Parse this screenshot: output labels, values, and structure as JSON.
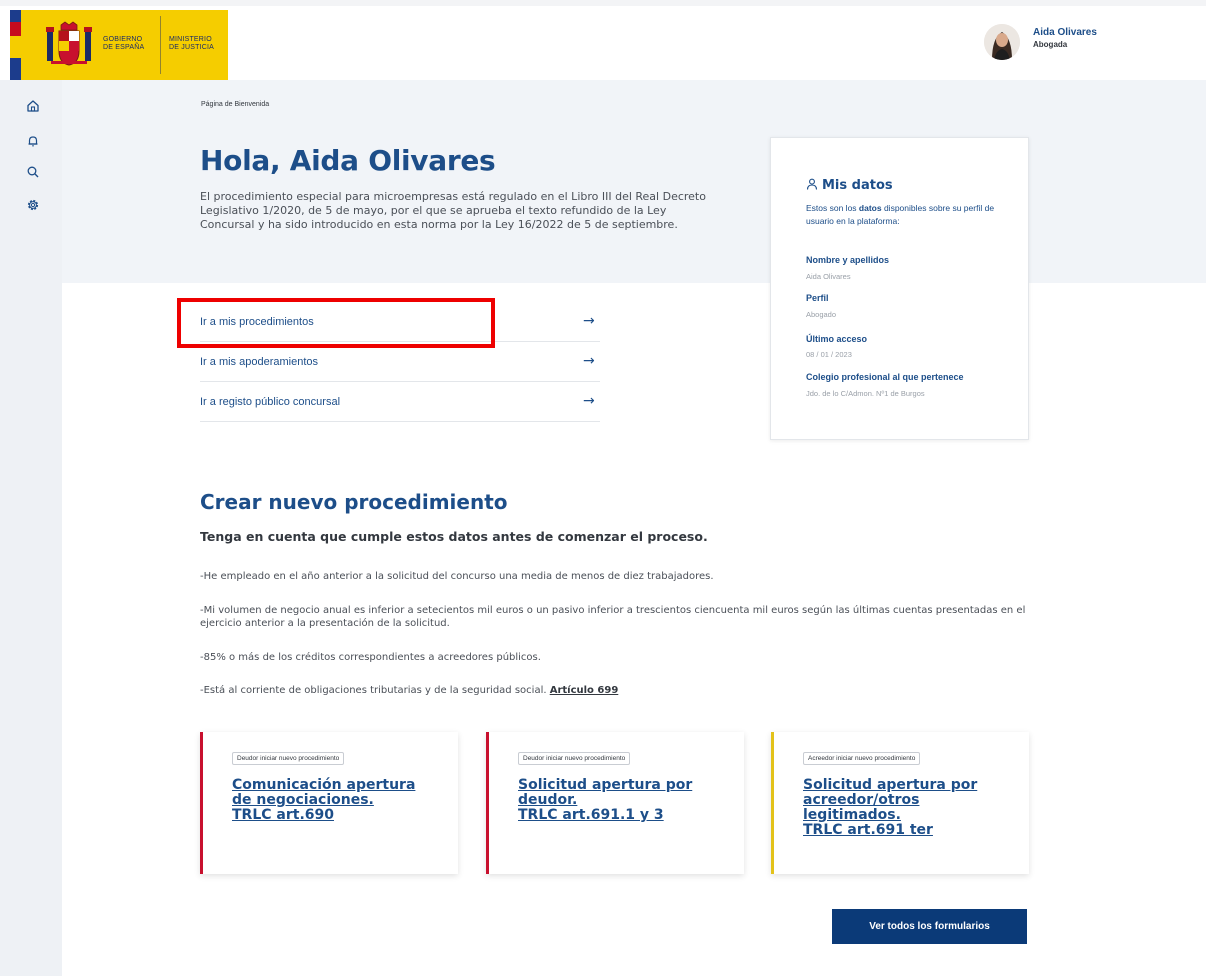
{
  "header": {
    "logo": {
      "gobierno": [
        "GOBIERNO",
        "DE ESPAÑA"
      ],
      "ministerio": [
        "MINISTERIO",
        "DE JUSTICIA"
      ]
    },
    "user": {
      "name": "Aida Olivares",
      "role": "Abogada"
    }
  },
  "sidebar": {
    "icons": [
      "home-icon",
      "bell-icon",
      "search-icon",
      "gear-icon"
    ]
  },
  "hero": {
    "breadcrumb": "Página de Bienvenida",
    "greeting": "Hola, Aida Olivares",
    "description": "El procedimiento especial para microempresas está regulado en el Libro III del Real Decreto Legislativo 1/2020, de 5 de mayo, por el que se aprueba el texto refundido de la Ley Concursal y ha sido introducido en esta norma por la Ley 16/2022 de 5 de septiembre."
  },
  "links": [
    {
      "label": "Ir a mis procedimientos",
      "arrow": "→"
    },
    {
      "label": "Ir a mis apoderamientos",
      "arrow": "→"
    },
    {
      "label": "Ir a registo público concursal",
      "arrow": "→"
    }
  ],
  "mis_datos": {
    "title": "Mis datos",
    "intro_pre": "Estos son los ",
    "intro_bold": "datos",
    "intro_post": " disponibles sobre su perfil de usuario en la plataforma:",
    "fields": [
      {
        "label": "Nombre y apellidos",
        "value": "Aida Olivares"
      },
      {
        "label": "Perfil",
        "value": "Abogado"
      },
      {
        "label": "Último acceso",
        "value": "08 / 01 / 2023"
      },
      {
        "label": "Colegio profesional al que pertenece",
        "value": "Jdo. de lo C/Admon. Nº1 de Burgos"
      }
    ]
  },
  "crear": {
    "title": "Crear nuevo procedimiento",
    "subtitle": "Tenga en cuenta que cumple estos datos antes de comenzar el proceso.",
    "requirements": [
      "-He empleado en el año anterior a la solicitud del concurso una media de menos de diez trabajadores.",
      "-Mi volumen de negocio  anual es inferior a setecientos mil  euros o un pasivo inferior a trescientos ciencuenta mil  euros según las últimas cuentas presentadas en el ejercicio anterior a la presentación de la solicitud.",
      "-85% o más de los créditos correspondientes a acreedores públicos.",
      "-Está al corriente de obligaciones tributarias y de la seguridad social. "
    ],
    "article_link": "Artículo 699"
  },
  "procedure_cards": [
    {
      "tag": "Deudor iniciar nuevo procedimiento",
      "title_lines": [
        "Comunicación apertura",
        "de negociaciones.",
        "TRLC art.690"
      ],
      "accent": "#c8102e"
    },
    {
      "tag": "Deudor iniciar nuevo procedimiento",
      "title_lines": [
        "Solicitud apertura por",
        "deudor.",
        "TRLC art.691.1 y 3"
      ],
      "accent": "#c8102e"
    },
    {
      "tag": "Acreedor iniciar nuevo procedimiento",
      "title_lines": [
        "Solicitud apertura por",
        "acreedor/otros",
        "legitimados.",
        "TRLC art.691 ter"
      ],
      "accent": "#e3c21a"
    }
  ],
  "buttons": {
    "ver_todos": "Ver todos los formularios"
  },
  "colors": {
    "primary": "#1d4e89",
    "button": "#0b3a78",
    "highlight": "#ee0000",
    "logo_bg": "#f5cd00"
  }
}
